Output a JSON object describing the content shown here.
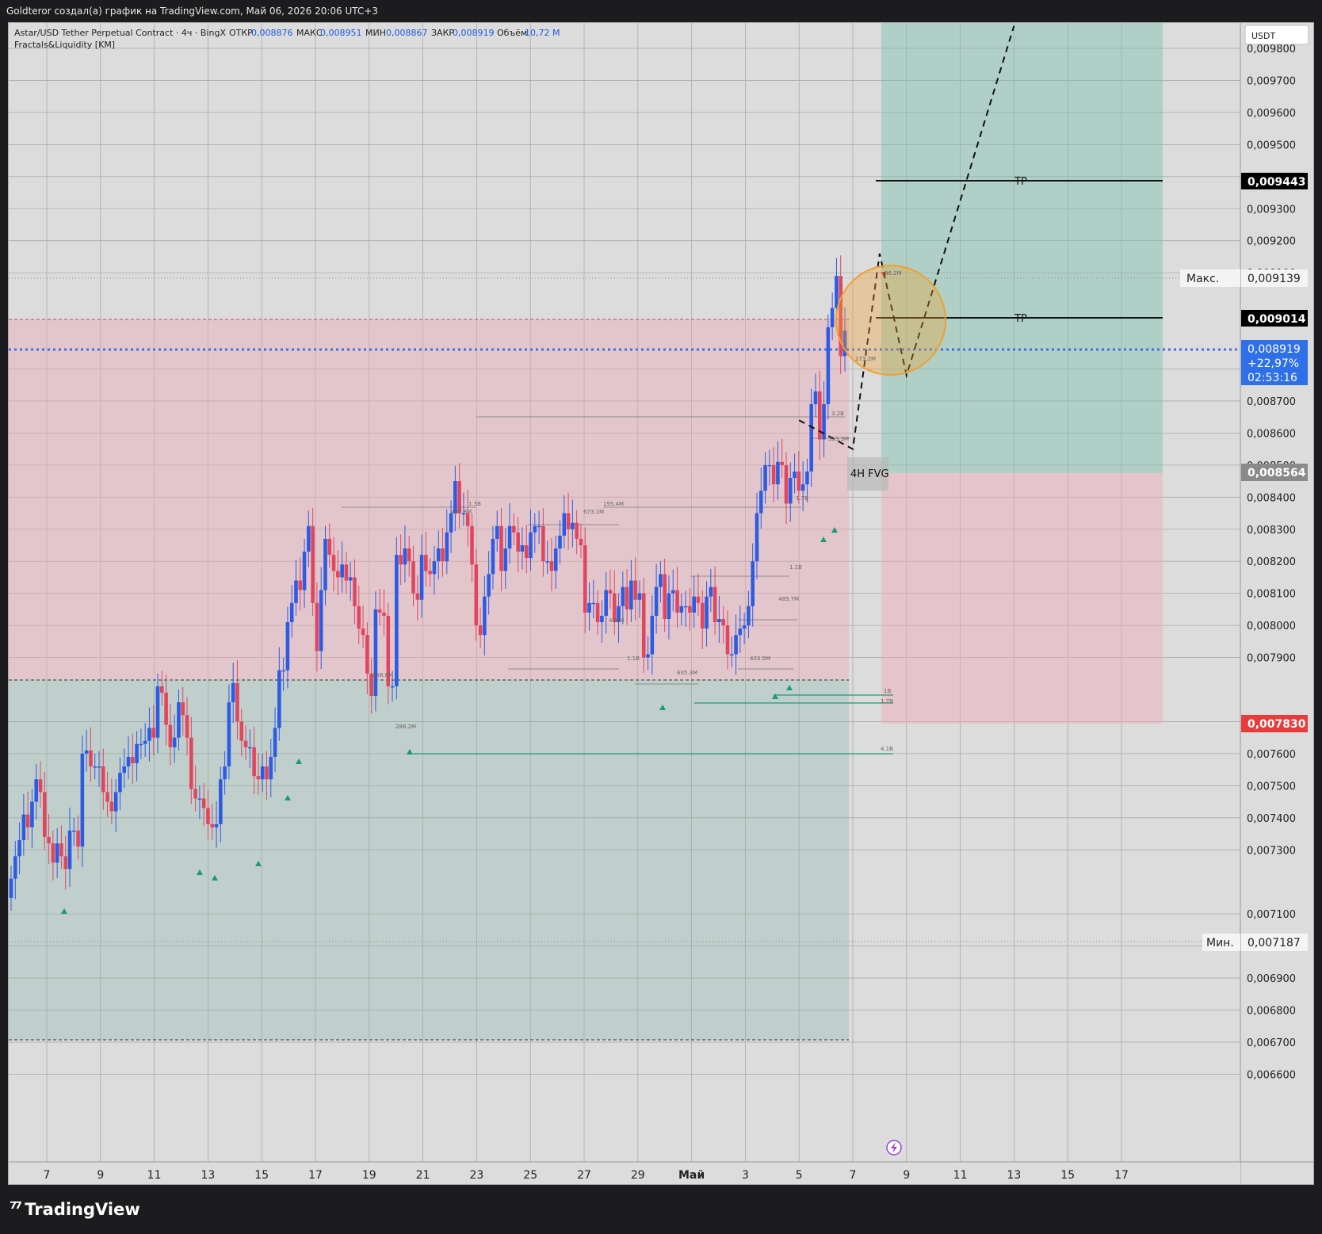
{
  "header": {
    "attribution": "Goldteror создал(а) график на TradingView.com, Май 06, 2026 20:06 UTC+3"
  },
  "legend": {
    "symbol": "Astar/USD Tether Perpetual Contract · 4ч · BingX",
    "open_label": "ОТКР",
    "open_value": "0,008876",
    "high_label": "МАКС",
    "high_value": "0,008951",
    "low_label": "МИН",
    "low_value": "0,008867",
    "close_label": "ЗАКР",
    "close_value": "0,008919",
    "volume_label": "Объём",
    "volume_value": "10,72 M",
    "indicator": "Fractals&Liquidity [KM]"
  },
  "price_axis": {
    "currency": "USDT",
    "ticks": [
      "0,009800",
      "0,009700",
      "0,009600",
      "0,009500",
      "0,009400",
      "0,009300",
      "0,009200",
      "0,009100",
      "0,008800",
      "0,008700",
      "0,008600",
      "0,008500",
      "0,008400",
      "0,008300",
      "0,008200",
      "0,008100",
      "0,008000",
      "0,007900",
      "0,007700",
      "0,007600",
      "0,007500",
      "0,007400",
      "0,007300",
      "0,007100",
      "0,007000",
      "0,006900",
      "0,006800",
      "0,006700",
      "0,006600"
    ],
    "badges": {
      "tp_upper": "0,009443",
      "max_label": "Макс.",
      "max_value": "0,009139",
      "tp_lower": "0,009014",
      "last": "0,008919",
      "change": "+22,97%",
      "timer": "02:53:16",
      "entry": "0,008564",
      "stop": "0,007830",
      "min_label": "Мин.",
      "min_value": "0,007187"
    }
  },
  "time_axis": {
    "labels": [
      "7",
      "9",
      "11",
      "13",
      "15",
      "17",
      "19",
      "21",
      "23",
      "25",
      "27",
      "29",
      "Май",
      "3",
      "5",
      "7",
      "9",
      "11",
      "13",
      "15",
      "17"
    ]
  },
  "annotations": {
    "tp1": "TP",
    "tp2": "TP",
    "fvg": "4H FVG",
    "liquidity_labels": [
      "1.3B",
      "407.8M",
      "673.1M",
      "195.4M",
      "3.2B",
      "353.3M",
      "273.2M",
      "96.2M",
      "1.7B",
      "1.1B",
      "489.7M",
      "436M",
      "1.1B",
      "403.5M",
      "605.3M",
      "258.8M",
      "288.2M",
      "1B",
      "1.7B",
      "4.1B"
    ]
  },
  "chart_data": {
    "type": "candlestick",
    "title": "Astar/USD Tether Perpetual Contract · 4ч · BingX",
    "interval": "4h",
    "currency": "USDT",
    "x_labels": [
      "7",
      "9",
      "11",
      "13",
      "15",
      "17",
      "19",
      "21",
      "23",
      "25",
      "27",
      "29",
      "Май",
      "3",
      "5",
      "7",
      "9",
      "11",
      "13",
      "15",
      "17"
    ],
    "ylim": [
      0.00655,
      0.00985
    ],
    "closes": [
      0.00721,
      0.00728,
      0.00733,
      0.00741,
      0.00737,
      0.00745,
      0.00752,
      0.00748,
      0.00734,
      0.00732,
      0.00726,
      0.00732,
      0.00728,
      0.00724,
      0.00736,
      0.00736,
      0.00731,
      0.0076,
      0.00761,
      0.00756,
      0.00756,
      0.00756,
      0.00748,
      0.00745,
      0.00742,
      0.00748,
      0.00754,
      0.00756,
      0.00759,
      0.00757,
      0.00763,
      0.00763,
      0.00764,
      0.00768,
      0.00765,
      0.00781,
      0.00779,
      0.00769,
      0.00762,
      0.00765,
      0.00776,
      0.00772,
      0.00765,
      0.00749,
      0.00746,
      0.00746,
      0.00743,
      0.00738,
      0.00737,
      0.00738,
      0.00752,
      0.00756,
      0.00776,
      0.00782,
      0.0077,
      0.00764,
      0.00762,
      0.00762,
      0.00753,
      0.00752,
      0.00756,
      0.00752,
      0.00759,
      0.00768,
      0.00786,
      0.00786,
      0.00801,
      0.00807,
      0.00814,
      0.00811,
      0.00823,
      0.00831,
      0.00807,
      0.00792,
      0.00811,
      0.00827,
      0.00822,
      0.00817,
      0.00815,
      0.00819,
      0.00814,
      0.00815,
      0.00806,
      0.00799,
      0.00797,
      0.00785,
      0.00778,
      0.00805,
      0.00804,
      0.00803,
      0.00781,
      0.00781,
      0.00822,
      0.00819,
      0.00824,
      0.0082,
      0.0081,
      0.00808,
      0.00822,
      0.00817,
      0.00816,
      0.0082,
      0.00824,
      0.0082,
      0.00829,
      0.00835,
      0.00845,
      0.00835,
      0.00835,
      0.00831,
      0.00819,
      0.008,
      0.00797,
      0.00809,
      0.00816,
      0.00827,
      0.00831,
      0.00817,
      0.00824,
      0.00831,
      0.00829,
      0.00823,
      0.00825,
      0.00821,
      0.00829,
      0.00831,
      0.00831,
      0.0082,
      0.0082,
      0.00817,
      0.00824,
      0.00828,
      0.00835,
      0.0083,
      0.00832,
      0.00827,
      0.00825,
      0.00804,
      0.00807,
      0.00807,
      0.00801,
      0.00803,
      0.00811,
      0.0081,
      0.00801,
      0.00806,
      0.00812,
      0.00805,
      0.00814,
      0.00808,
      0.0081,
      0.0079,
      0.00791,
      0.00803,
      0.00812,
      0.00816,
      0.00802,
      0.0081,
      0.00811,
      0.00804,
      0.00806,
      0.00806,
      0.00804,
      0.00809,
      0.00807,
      0.00799,
      0.00809,
      0.00812,
      0.00801,
      0.00802,
      0.008,
      0.00791,
      0.00791,
      0.00797,
      0.00799,
      0.008,
      0.00806,
      0.0082,
      0.00835,
      0.00842,
      0.0085,
      0.0085,
      0.00844,
      0.00851,
      0.0085,
      0.00838,
      0.00846,
      0.00848,
      0.00842,
      0.00844,
      0.00848,
      0.00869,
      0.00873,
      0.00858,
      0.00869,
      0.00893,
      0.00899,
      0.00909,
      0.00884,
      0.00892
    ],
    "last_price": 0.008919,
    "session_ohlc": {
      "open": 0.008876,
      "high": 0.008951,
      "low": 0.008867,
      "close": 0.008919,
      "volume": "10,72 M"
    },
    "levels": {
      "tp_upper": 0.009443,
      "high": 0.009139,
      "tp_lower": 0.009014,
      "last": 0.008919,
      "entry": 0.008564,
      "stop": 0.00783,
      "low": 0.007187
    },
    "long_position": {
      "entry": 0.008564,
      "target": 0.009443,
      "stop": 0.00783
    },
    "projection_path": [
      {
        "date": "5",
        "price": 0.00864
      },
      {
        "date": "7",
        "price": 0.00855
      },
      {
        "date": "8",
        "price": 0.00916
      },
      {
        "date": "9",
        "price": 0.00878
      },
      {
        "date": "13",
        "price": 0.00987
      }
    ]
  }
}
